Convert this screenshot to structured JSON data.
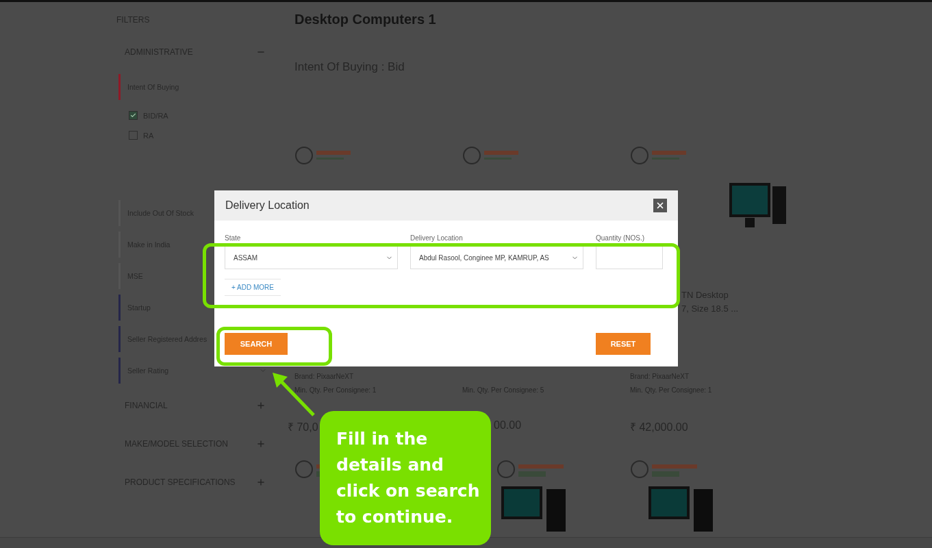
{
  "sidebar": {
    "title": "FILTERS",
    "sections": [
      {
        "label": "ADMINISTRATIVE",
        "expanded": true,
        "filters": [
          {
            "label": "Intent Of Buying",
            "color": "#8e1a27",
            "options": [
              {
                "label": "BID/RA",
                "checked": true
              },
              {
                "label": "RA",
                "checked": false
              }
            ]
          },
          {
            "label": "Include Out Of Stock",
            "color": "#555555"
          },
          {
            "label": "Make in India",
            "color": "#555555"
          },
          {
            "label": "MSE",
            "color": "#555555"
          },
          {
            "label": "Startup",
            "color": "#25264a"
          },
          {
            "label": "Seller Registered Addres",
            "color": "#25264a"
          },
          {
            "label": "Seller Rating",
            "color": "#25264a"
          }
        ]
      },
      {
        "label": "FINANCIAL",
        "expanded": false
      },
      {
        "label": "MAKE/MODEL SELECTION",
        "expanded": false
      },
      {
        "label": "PRODUCT SPECIFICATIONS",
        "expanded": false
      }
    ]
  },
  "main": {
    "title": "Desktop Computers 1",
    "subtitle": "Intent Of Buying : Bid",
    "products": [
      {
        "brand": "Brand: PixaarNeXT",
        "min_qty": "Min. Qty. Per Consignee: 1",
        "price": "₹ 70,0"
      },
      {
        "min_qty": "Min. Qty. Per Consignee: 5",
        "price": "00.00"
      },
      {
        "title_lines": [
          "TN Desktop",
          "7, Size 18.5 ..."
        ],
        "brand": "Brand: PixaarNeXT",
        "min_qty": "Min. Qty. Per Consignee: 1",
        "price": "₹ 42,000.00"
      }
    ]
  },
  "dialog": {
    "title": "Delivery Location",
    "fields": [
      {
        "kind": "select",
        "label": "State",
        "value": "ASSAM"
      },
      {
        "kind": "select",
        "label": "Delivery Location",
        "value": "Abdul Rasool, Conginee MP, KAMRUP, AS"
      },
      {
        "kind": "input",
        "label": "Quantity (NOS.)"
      }
    ],
    "add_more": "+ ADD MORE",
    "buttons": [
      "SEARCH",
      "RESET"
    ]
  },
  "callout": {
    "text": "Fill in the details and click on search to continue."
  }
}
